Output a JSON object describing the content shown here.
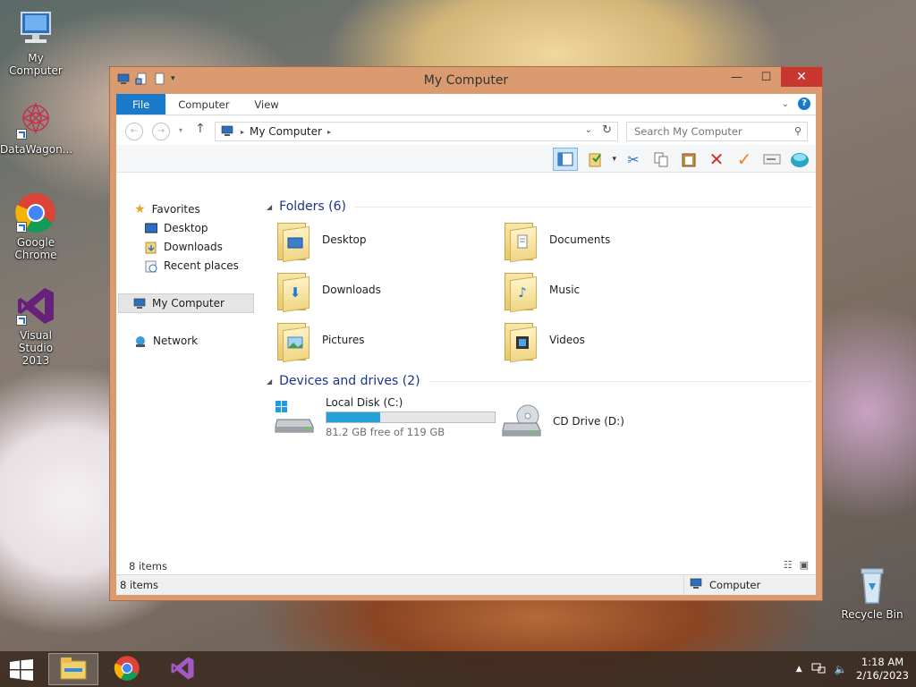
{
  "desktop": {
    "icons": [
      {
        "label": "My Computer"
      },
      {
        "label": "DataWagon..."
      },
      {
        "label": "Google Chrome"
      },
      {
        "label": "Visual Studio 2013"
      },
      {
        "label": "Recycle Bin"
      }
    ]
  },
  "window": {
    "title": "My Computer",
    "tabs": [
      {
        "label": "File"
      },
      {
        "label": "Computer"
      },
      {
        "label": "View"
      }
    ],
    "address": {
      "crumb": "My Computer"
    },
    "search": {
      "placeholder": "Search My Computer"
    },
    "close_glyph": "✕",
    "maximize_glyph": "☐",
    "minimize_glyph": "—"
  },
  "navpane": {
    "favorites": "Favorites",
    "desktop": "Desktop",
    "downloads": "Downloads",
    "recent": "Recent places",
    "my_computer": "My Computer",
    "network": "Network"
  },
  "content": {
    "folders_header": "Folders (6)",
    "folders": [
      {
        "name": "Desktop"
      },
      {
        "name": "Documents"
      },
      {
        "name": "Downloads"
      },
      {
        "name": "Music"
      },
      {
        "name": "Pictures"
      },
      {
        "name": "Videos"
      }
    ],
    "devices_header": "Devices and drives (2)",
    "drives": [
      {
        "name": "Local Disk (C:)",
        "free": "81.2 GB free of 119 GB",
        "used_fraction": 0.32
      },
      {
        "name": "CD Drive (D:)"
      }
    ]
  },
  "status": {
    "items_count": "8 items",
    "status_left": "8 items",
    "status_right": "Computer"
  },
  "taskbar": {
    "time": "1:18 AM",
    "date": "2/16/2023"
  },
  "colors": {
    "file_tab": "#1979ca",
    "close_button": "#c7372f",
    "drive_fill": "#26a0da",
    "frame": "#d99b6f"
  }
}
